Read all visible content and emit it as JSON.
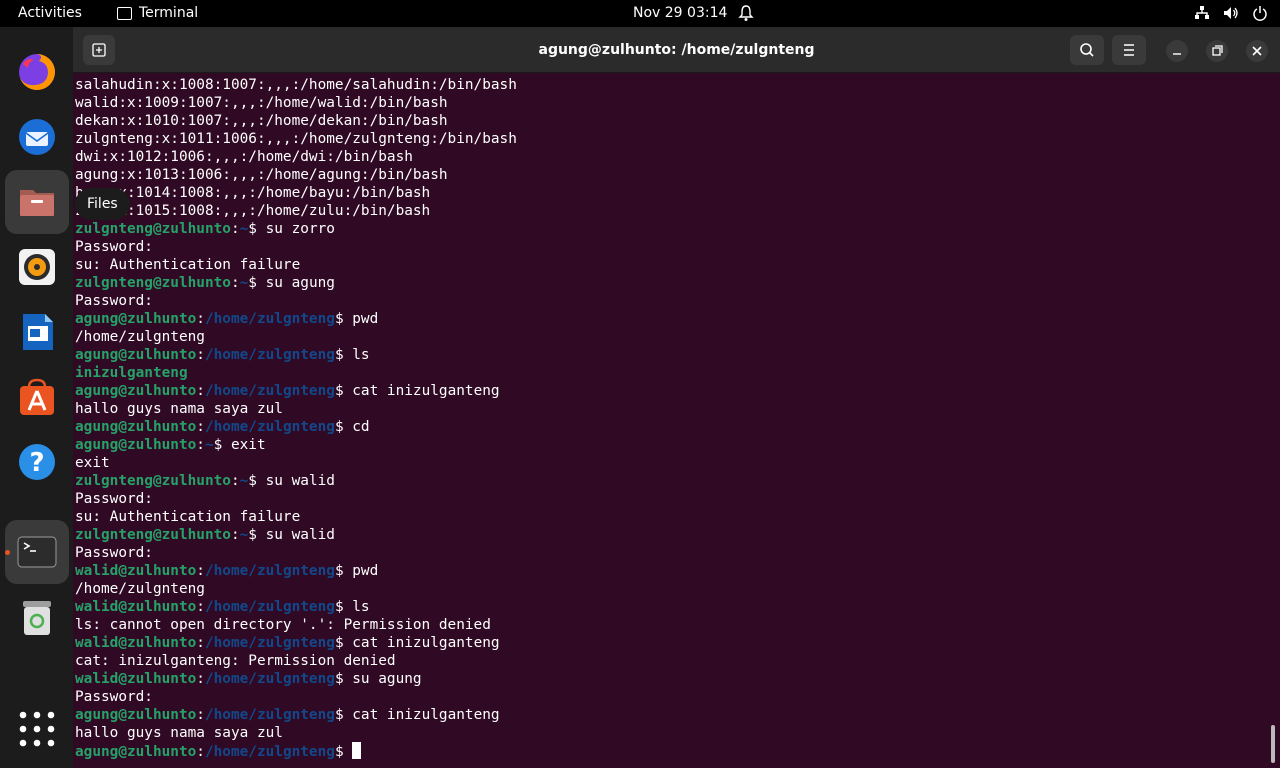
{
  "topbar": {
    "activities": "Activities",
    "app_name": "Terminal",
    "clock": "Nov 29  03:14"
  },
  "dock": {
    "tooltip": "Files",
    "items": [
      "firefox-icon",
      "thunderbird-icon",
      "files-icon",
      "rhythmbox-icon",
      "writer-icon",
      "app-center-icon",
      "help-icon",
      "terminal-icon",
      "trash-icon",
      "show-apps-icon"
    ]
  },
  "window": {
    "title": "agung@zulhunto: /home/zulgnteng"
  },
  "terminal": {
    "lines": [
      {
        "text": "salahudin:x:1008:1007:,,,:/home/salahudin:/bin/bash"
      },
      {
        "text": "walid:x:1009:1007:,,,:/home/walid:/bin/bash"
      },
      {
        "text": "dekan:x:1010:1007:,,,:/home/dekan:/bin/bash"
      },
      {
        "text": "zulgnteng:x:1011:1006:,,,:/home/zulgnteng:/bin/bash"
      },
      {
        "text": "dwi:x:1012:1006:,,,:/home/dwi:/bin/bash"
      },
      {
        "text": "agung:x:1013:1006:,,,:/home/agung:/bin/bash"
      },
      {
        "text": "bayu:x:1014:1008:,,,:/home/bayu:/bin/bash"
      },
      {
        "text": "zulu:x:1015:1008:,,,:/home/zulu:/bin/bash"
      },
      {
        "user": "zulgnteng@zulhunto",
        "path": "~",
        "cmd": " su zorro"
      },
      {
        "text": "Password:"
      },
      {
        "text": "su: Authentication failure"
      },
      {
        "user": "zulgnteng@zulhunto",
        "path": "~",
        "cmd": " su agung"
      },
      {
        "text": "Password:"
      },
      {
        "user": "agung@zulhunto",
        "path": "/home/zulgnteng",
        "cmd": " pwd"
      },
      {
        "text": "/home/zulgnteng"
      },
      {
        "user": "agung@zulhunto",
        "path": "/home/zulgnteng",
        "cmd": " ls"
      },
      {
        "dir": "inizulganteng"
      },
      {
        "user": "agung@zulhunto",
        "path": "/home/zulgnteng",
        "cmd": " cat inizulganteng"
      },
      {
        "text": "hallo guys nama saya zul"
      },
      {
        "user": "agung@zulhunto",
        "path": "/home/zulgnteng",
        "cmd": " cd"
      },
      {
        "user": "agung@zulhunto",
        "path": "~",
        "cmd": " exit"
      },
      {
        "text": "exit"
      },
      {
        "user": "zulgnteng@zulhunto",
        "path": "~",
        "cmd": " su walid"
      },
      {
        "text": "Password:"
      },
      {
        "text": "su: Authentication failure"
      },
      {
        "user": "zulgnteng@zulhunto",
        "path": "~",
        "cmd": " su walid"
      },
      {
        "text": "Password:"
      },
      {
        "user": "walid@zulhunto",
        "path": "/home/zulgnteng",
        "cmd": " pwd"
      },
      {
        "text": "/home/zulgnteng"
      },
      {
        "user": "walid@zulhunto",
        "path": "/home/zulgnteng",
        "cmd": " ls"
      },
      {
        "text": "ls: cannot open directory '.': Permission denied"
      },
      {
        "user": "walid@zulhunto",
        "path": "/home/zulgnteng",
        "cmd": " cat inizulganteng"
      },
      {
        "text": "cat: inizulganteng: Permission denied"
      },
      {
        "user": "walid@zulhunto",
        "path": "/home/zulgnteng",
        "cmd": " su agung"
      },
      {
        "text": "Password:"
      },
      {
        "user": "agung@zulhunto",
        "path": "/home/zulgnteng",
        "cmd": " cat inizulganteng"
      },
      {
        "text": "hallo guys nama saya zul"
      },
      {
        "user": "agung@zulhunto",
        "path": "/home/zulgnteng",
        "cmd": " ",
        "cursor": true
      }
    ]
  }
}
